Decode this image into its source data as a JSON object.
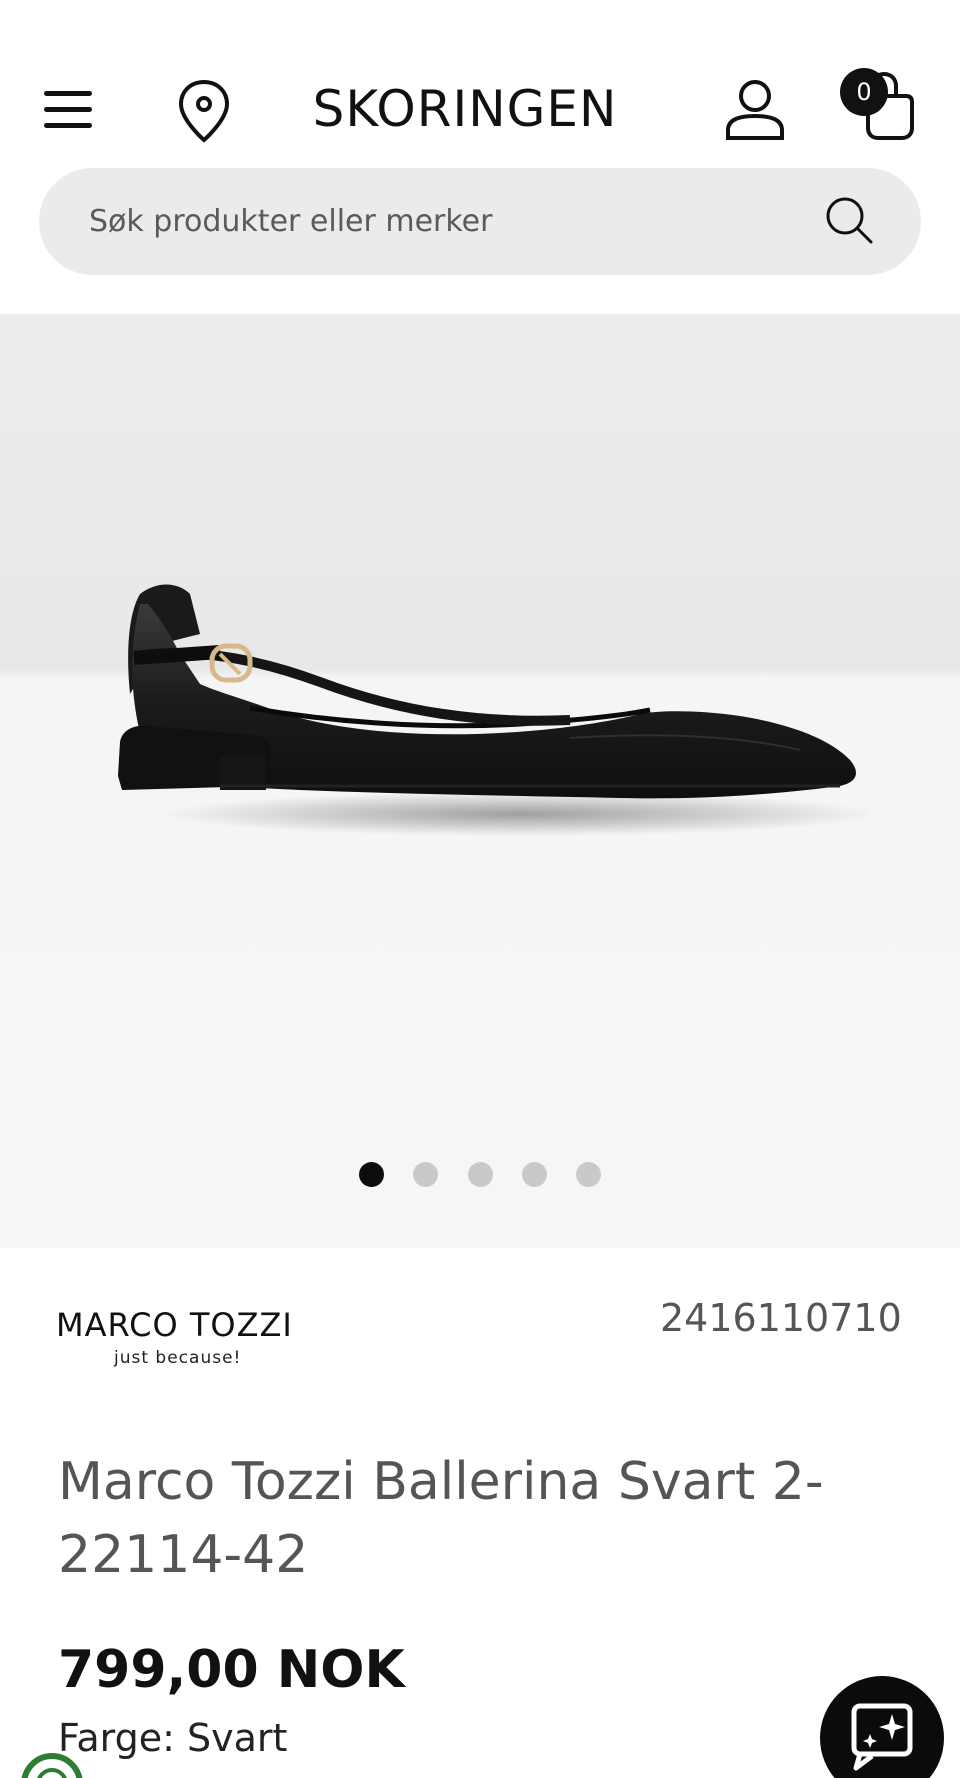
{
  "header": {
    "logo": "SKORINGEN",
    "cart_count": "0"
  },
  "search": {
    "placeholder": "Søk produkter eller merker"
  },
  "gallery": {
    "slide_count": 5,
    "active_slide": 1
  },
  "product": {
    "brand_name": "MARCO TOZZI",
    "brand_tagline": "just because!",
    "sku": "2416110710",
    "title": "Marco Tozzi Ballerina Svart 2-22114-42",
    "price": "799,00 NOK",
    "color": "Farge: Svart"
  },
  "icons": {
    "menu": "hamburger-menu-icon",
    "location": "location-pin-icon",
    "account": "user-icon",
    "cart": "shopping-bag-icon",
    "search": "search-icon",
    "chat": "chat-sparkle-icon",
    "eco": "eco-badge-icon"
  },
  "colors": {
    "text_dark": "#111111",
    "text_muted": "#555555",
    "search_bg": "#ebebeb",
    "gallery_bg": "#f6f6f6",
    "dot_active": "#0d0d0d",
    "dot_inactive": "#c9c9c9",
    "eco_green": "#2e7d32"
  }
}
